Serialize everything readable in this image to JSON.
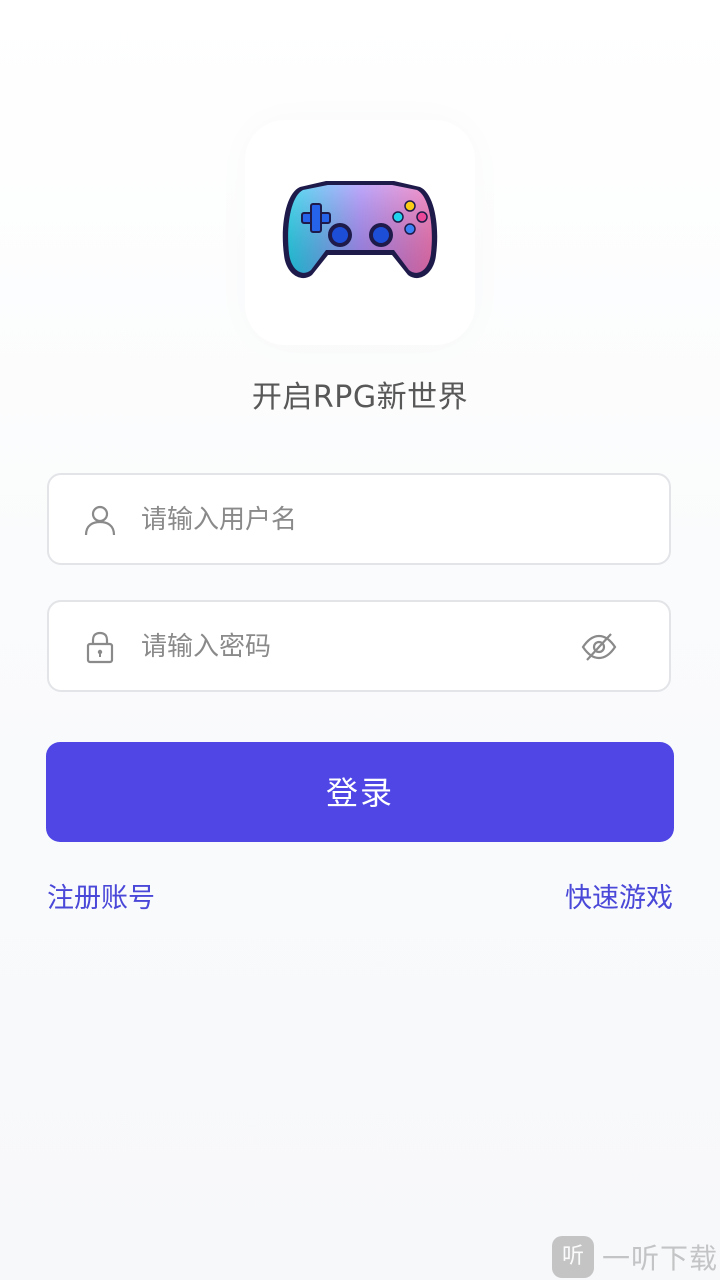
{
  "app": {
    "tagline": "开启RPG新世界",
    "logo_icon": "gamepad-icon"
  },
  "form": {
    "username": {
      "placeholder": "请输入用户名",
      "value": "",
      "icon": "user-icon"
    },
    "password": {
      "placeholder": "请输入密码",
      "value": "",
      "icon": "lock-icon",
      "toggle_icon": "eye-off-icon"
    },
    "login_label": "登录"
  },
  "links": {
    "register": "注册账号",
    "quick_play": "快速游戏"
  },
  "watermark": {
    "badge": "听",
    "text": "一听下载"
  },
  "colors": {
    "accent": "#4f46e5",
    "link": "#4a48d8",
    "field_border": "#e3e4e7"
  }
}
